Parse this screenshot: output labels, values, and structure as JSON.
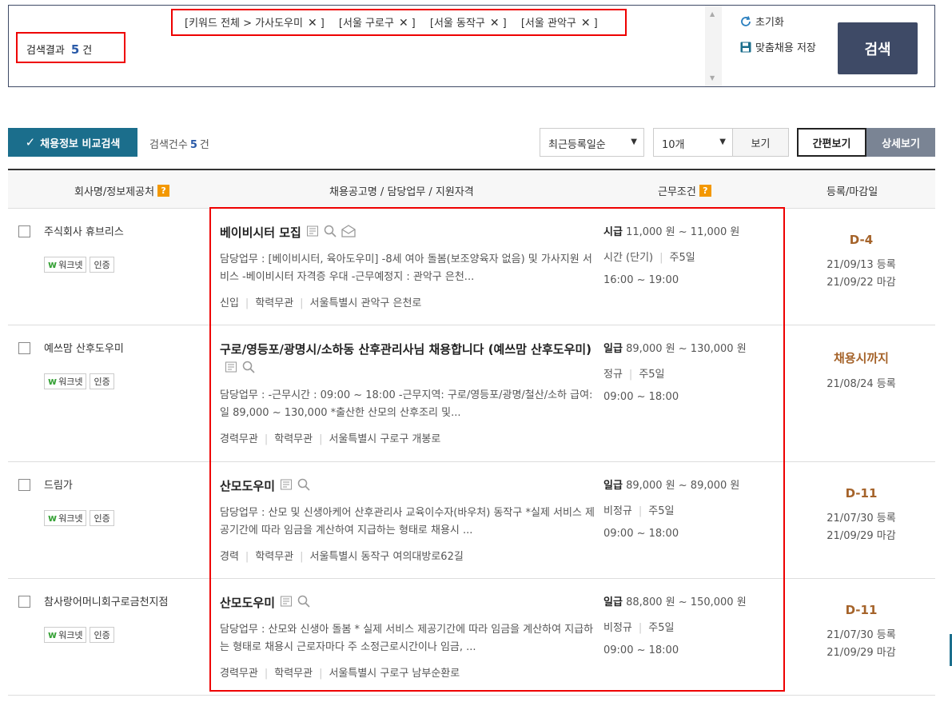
{
  "search": {
    "result_label": "검색결과",
    "result_count": "5",
    "result_unit": "건",
    "chips": [
      {
        "label": "[키워드 전체 > 가사도우미"
      },
      {
        "label": "[서울 구로구"
      },
      {
        "label": "[서울 동작구"
      },
      {
        "label": "[서울 관악구"
      }
    ],
    "chip_close": "✕",
    "chip_end": "]",
    "reset_label": "초기화",
    "save_label": "맞춤채용 저장",
    "search_button": "검색"
  },
  "toolbar": {
    "compare_button": "채용정보 비교검색",
    "count_label": "검색건수",
    "count_value": "5",
    "count_unit": "건",
    "sort_selected": "최근등록일순",
    "size_selected": "10개",
    "view_button": "보기",
    "simple_view": "간편보기",
    "detail_view": "상세보기"
  },
  "table": {
    "headers": [
      "회사명/정보제공처",
      "채용공고명 / 담당업무 / 지원자격",
      "근무조건",
      "등록/마감일"
    ],
    "help_mark": "?",
    "badge_worknet": "워크넷",
    "badge_cert": "인증",
    "rows": [
      {
        "company": "주식회사 휴브리스",
        "title": "베이비시터 모집",
        "desc": "담당업무 : [베이비시터, 육아도우미] -8세 여아 돌봄(보조양육자 없음) 및 가사지원 서비스 -베이비시터 자격증 우대 -근무예정지 : 관악구 은천...",
        "meta": [
          "신입",
          "학력무관",
          "서울특별시 관악구 은천로"
        ],
        "pay_type": "시급",
        "pay": "11,000 원 ~ 11,000 원",
        "emp": "시간 (단기)",
        "days": "주5일",
        "hours": "16:00 ~ 19:00",
        "dday": "D-4",
        "reg": "21/09/13 등록",
        "close": "21/09/22 마감"
      },
      {
        "company": "예쓰맘 산후도우미",
        "title": "구로/영등포/광명시/소하동 산후관리사님 채용합니다 (예쓰맘 산후도우미)",
        "desc": "담당업무 : -근무시간 : 09:00 ~ 18:00 -근무지역: 구로/영등포/광명/철산/소하 급여: 일 89,000 ~ 130,000 *출산한 산모의 산후조리 및...",
        "meta": [
          "경력무관",
          "학력무관",
          "서울특별시 구로구 개봉로"
        ],
        "pay_type": "일급",
        "pay": "89,000 원 ~ 130,000 원",
        "emp": "정규",
        "days": "주5일",
        "hours": "09:00 ~ 18:00",
        "dday": "채용시까지",
        "reg": "21/08/24 등록",
        "close": ""
      },
      {
        "company": "드림가",
        "title": "산모도우미",
        "desc": "담당업무 : 산모 및 신생아케어 산후관리사 교육이수자(바우처) 동작구 *실제 서비스 제공기간에 따라 임금을 계산하여 지급하는 형태로 채용시 ...",
        "meta": [
          "경력",
          "학력무관",
          "서울특별시 동작구 여의대방로62길"
        ],
        "pay_type": "일급",
        "pay": "89,000 원 ~ 89,000 원",
        "emp": "비정규",
        "days": "주5일",
        "hours": "09:00 ~ 18:00",
        "dday": "D-11",
        "reg": "21/07/30 등록",
        "close": "21/09/29 마감"
      },
      {
        "company": "참사랑어머니회구로금천지점",
        "title": "산모도우미",
        "desc": "담당업무 : 산모와 신생아 돌봄 * 실제 서비스 제공기간에 따라 임금을 계산하여 지급하는 형태로 채용시 근로자마다 주 소정근로시간이나 임금, ...",
        "meta": [
          "경력무관",
          "학력무관",
          "서울특별시 구로구 남부순환로"
        ],
        "pay_type": "일급",
        "pay": "88,800 원 ~ 150,000 원",
        "emp": "비정규",
        "days": "주5일",
        "hours": "09:00 ~ 18:00",
        "dday": "D-11",
        "reg": "21/07/30 등록",
        "close": "21/09/29 마감"
      }
    ]
  },
  "icons": {
    "scrap": "bookmark-icon",
    "preview": "magnifier-icon",
    "apply": "mail-icon"
  }
}
